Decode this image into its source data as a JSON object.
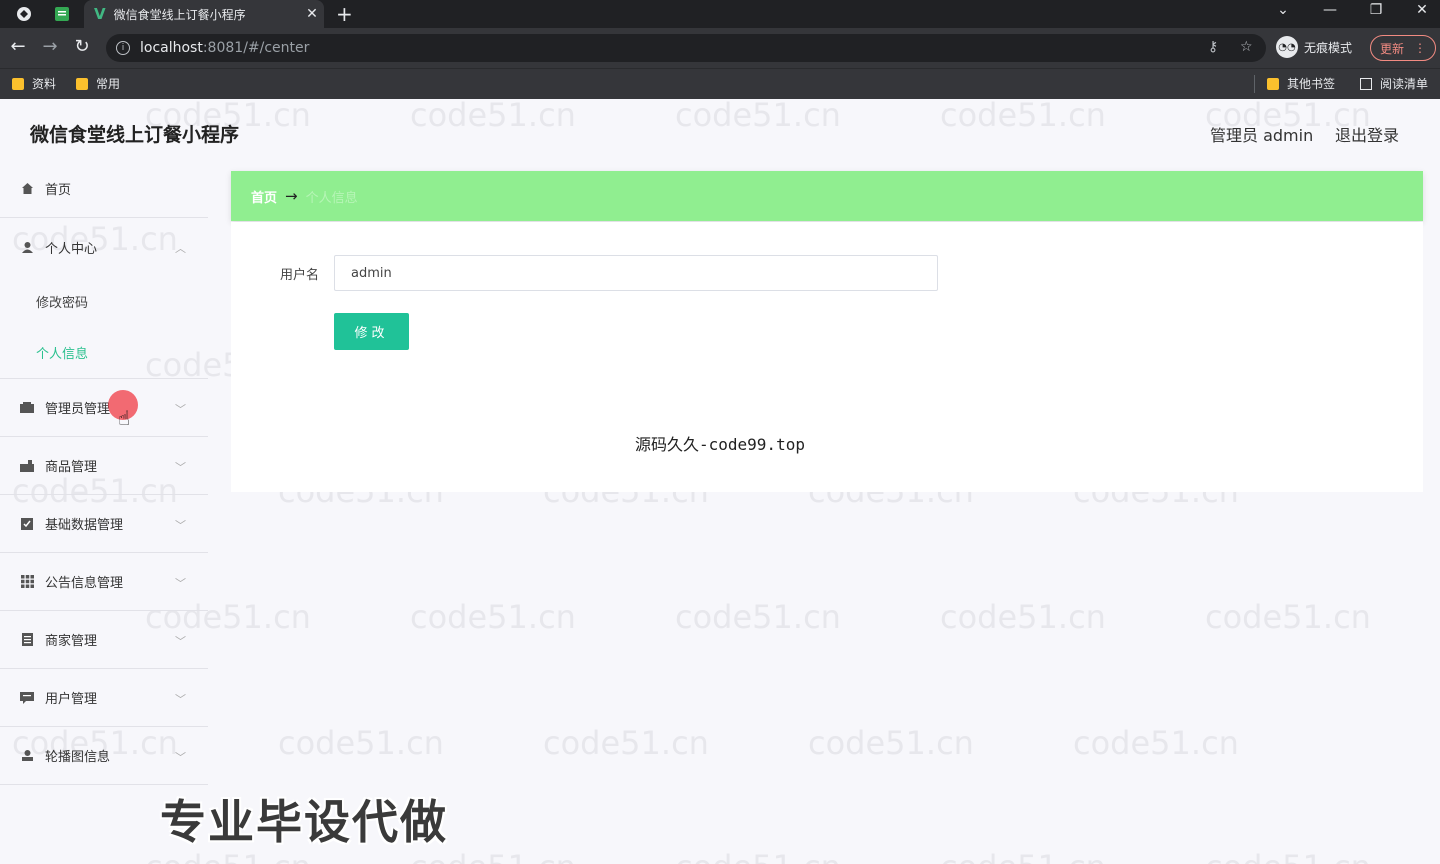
{
  "browser": {
    "tab_title": "微信食堂线上订餐小程序",
    "url_host": "localhost",
    "url_rest": ":8081/#/center",
    "incognito_label": "无痕模式",
    "update_label": "更新",
    "bookmarks_left": [
      "资料",
      "常用"
    ],
    "bookmarks_right": [
      "其他书签",
      "阅读清单"
    ]
  },
  "app": {
    "title": "微信食堂线上订餐小程序",
    "header_user": "管理员 admin",
    "header_logout": "退出登录"
  },
  "sidebar": {
    "home": "首页",
    "personal_center": "个人中心",
    "change_password": "修改密码",
    "personal_info": "个人信息",
    "items": [
      "管理员管理",
      "商品管理",
      "基础数据管理",
      "公告信息管理",
      "商家管理",
      "用户管理",
      "轮播图信息"
    ]
  },
  "breadcrumb": {
    "home": "首页",
    "arrow": "→",
    "current": "个人信息"
  },
  "form": {
    "username_label": "用户名",
    "username_value": "admin",
    "submit_label": "修改"
  },
  "captions": {
    "center": "源码久久-code99.top",
    "promo": "专业毕设代做"
  },
  "watermark": "code51.cn",
  "colors": {
    "accent": "#20c298",
    "breadcrumb_bg": "#90ee90"
  }
}
